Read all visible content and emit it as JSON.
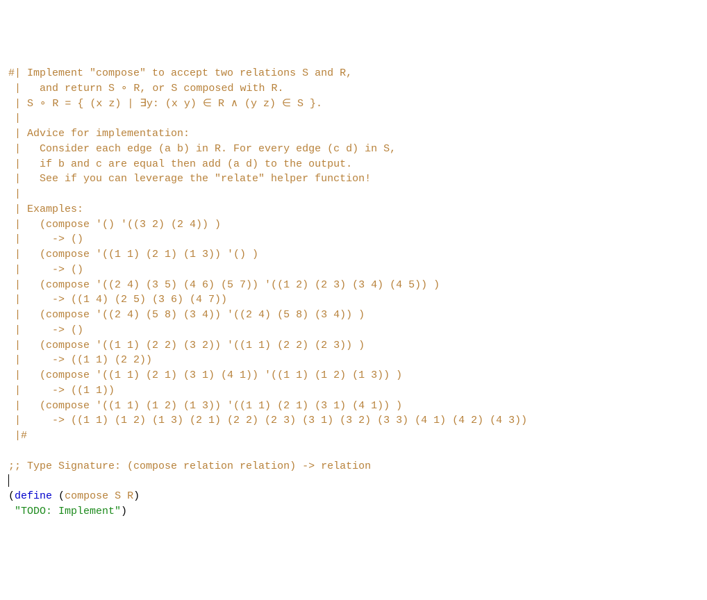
{
  "code": {
    "c1": "#| Implement \"compose\" to accept two relations S and R,",
    "c2": " |   and return S ∘ R, or S composed with R.",
    "c3": " | S ∘ R = { (x z) | ∃y: (x y) ∈ R ∧ (y z) ∈ S }.",
    "c4": " |",
    "c5": " | Advice for implementation:",
    "c6": " |   Consider each edge (a b) in R. For every edge (c d) in S,",
    "c7": " |   if b and c are equal then add (a d) to the output.",
    "c8": " |   See if you can leverage the \"relate\" helper function!",
    "c9": " |",
    "c10": " | Examples:",
    "c11": " |   (compose '() '((3 2) (2 4)) )",
    "c12": " |     -> ()",
    "c13": " |   (compose '((1 1) (2 1) (1 3)) '() )",
    "c14": " |     -> ()",
    "c15": " |   (compose '((2 4) (3 5) (4 6) (5 7)) '((1 2) (2 3) (3 4) (4 5)) )",
    "c16": " |     -> ((1 4) (2 5) (3 6) (4 7))",
    "c17": " |   (compose '((2 4) (5 8) (3 4)) '((2 4) (5 8) (3 4)) )",
    "c18": " |     -> ()",
    "c19": " |   (compose '((1 1) (2 2) (3 2)) '((1 1) (2 2) (2 3)) )",
    "c20": " |     -> ((1 1) (2 2))",
    "c21": " |   (compose '((1 1) (2 1) (3 1) (4 1)) '((1 1) (1 2) (1 3)) )",
    "c22": " |     -> ((1 1))",
    "c23": " |   (compose '((1 1) (1 2) (1 3)) '((1 1) (2 1) (3 1) (4 1)) )",
    "c24": " |     -> ((1 1) (1 2) (1 3) (2 1) (2 2) (2 3) (3 1) (3 2) (3 3) (4 1) (4 2) (4 3))",
    "c25": " |#",
    "c26": "",
    "c27": ";; Type Signature: (compose relation relation) -> relation",
    "define_kw": "define",
    "open1": "(",
    "open2": "(",
    "close2": ")",
    "func": "compose",
    "p1": "S",
    "p2": "R",
    "body": "\"TODO: Implement\"",
    "close1": ")"
  }
}
